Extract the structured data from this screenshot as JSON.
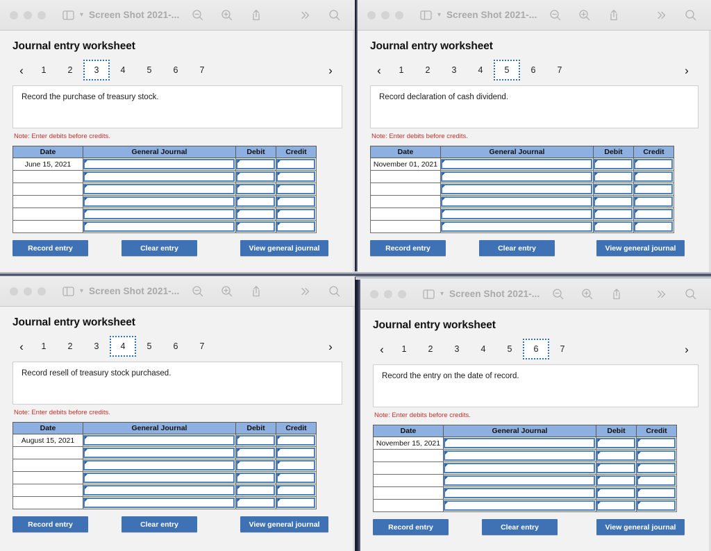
{
  "browser": {
    "window_title": "Screen Shot 2021-...",
    "icons": {
      "sidebar": "sidebar-icon",
      "sidebar_chevron": "chevron-down-icon",
      "zoom_out": "zoom-out-icon",
      "zoom_in": "zoom-in-icon",
      "share": "share-icon",
      "overflow": "double-chevron-right-icon",
      "search": "search-icon"
    },
    "traffic_lights": [
      "close",
      "minimize",
      "maximize"
    ]
  },
  "worksheet": {
    "heading": "Journal entry worksheet",
    "pages": [
      "1",
      "2",
      "3",
      "4",
      "5",
      "6",
      "7"
    ],
    "prev_arrow": "‹",
    "next_arrow": "›",
    "note": "Note: Enter debits before credits.",
    "columns": [
      "Date",
      "General Journal",
      "Debit",
      "Credit"
    ],
    "row_count": 6,
    "buttons": {
      "record": "Record entry",
      "clear": "Clear entry",
      "view": "View general journal"
    }
  },
  "colors": {
    "header_blue": "#8eb0e0",
    "button_blue": "#3f72b5",
    "cell_border_blue": "#4a7fc1",
    "note_red": "#c0302b",
    "page_bg": "#f2f2f2"
  },
  "panels": [
    {
      "id": "top-left",
      "selected_page": "3",
      "prompt": "Record the purchase of treasury stock.",
      "date": "June 15, 2021"
    },
    {
      "id": "top-right",
      "selected_page": "5",
      "prompt": "Record declaration of cash dividend.",
      "date": "November 01, 2021"
    },
    {
      "id": "bottom-left",
      "selected_page": "4",
      "prompt": "Record resell of treasury stock purchased.",
      "date": "August 15, 2021"
    },
    {
      "id": "bottom-right",
      "selected_page": "6",
      "prompt": "Record the entry on the date of record.",
      "date": "November 15, 2021"
    }
  ]
}
